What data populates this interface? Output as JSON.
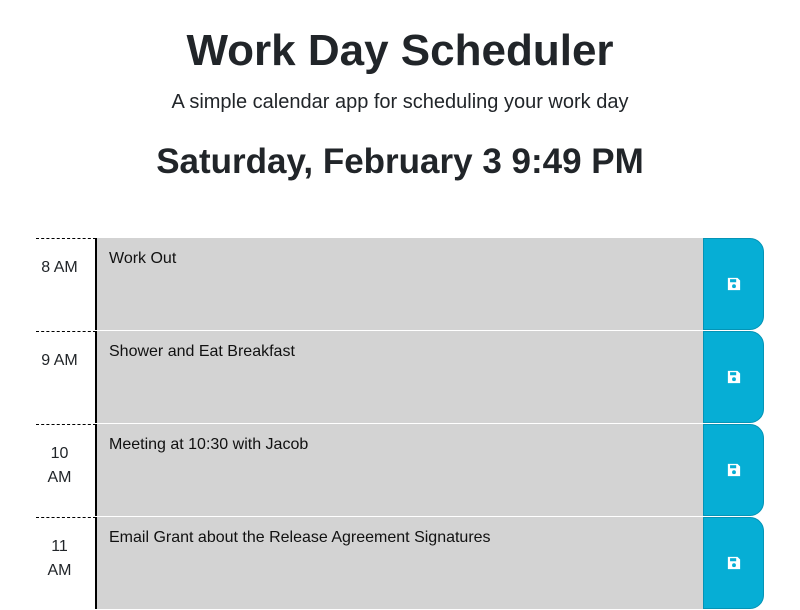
{
  "header": {
    "title": "Work Day Scheduler",
    "subtitle": "A simple calendar app for scheduling your work day",
    "current_date": "Saturday, February 3 9:49 PM"
  },
  "rows": [
    {
      "hour": "8 AM",
      "task": "Work Out"
    },
    {
      "hour": "9 AM",
      "task": "Shower and Eat Breakfast"
    },
    {
      "hour": "10 AM",
      "task": "Meeting at 10:30 with Jacob"
    },
    {
      "hour": "11 AM",
      "task": "Email Grant about the Release Agreement Signatures"
    }
  ],
  "colors": {
    "save_button": "#06aed5",
    "past_row": "#d3d3d3"
  },
  "icons": {
    "save": "floppy-disk-icon"
  }
}
